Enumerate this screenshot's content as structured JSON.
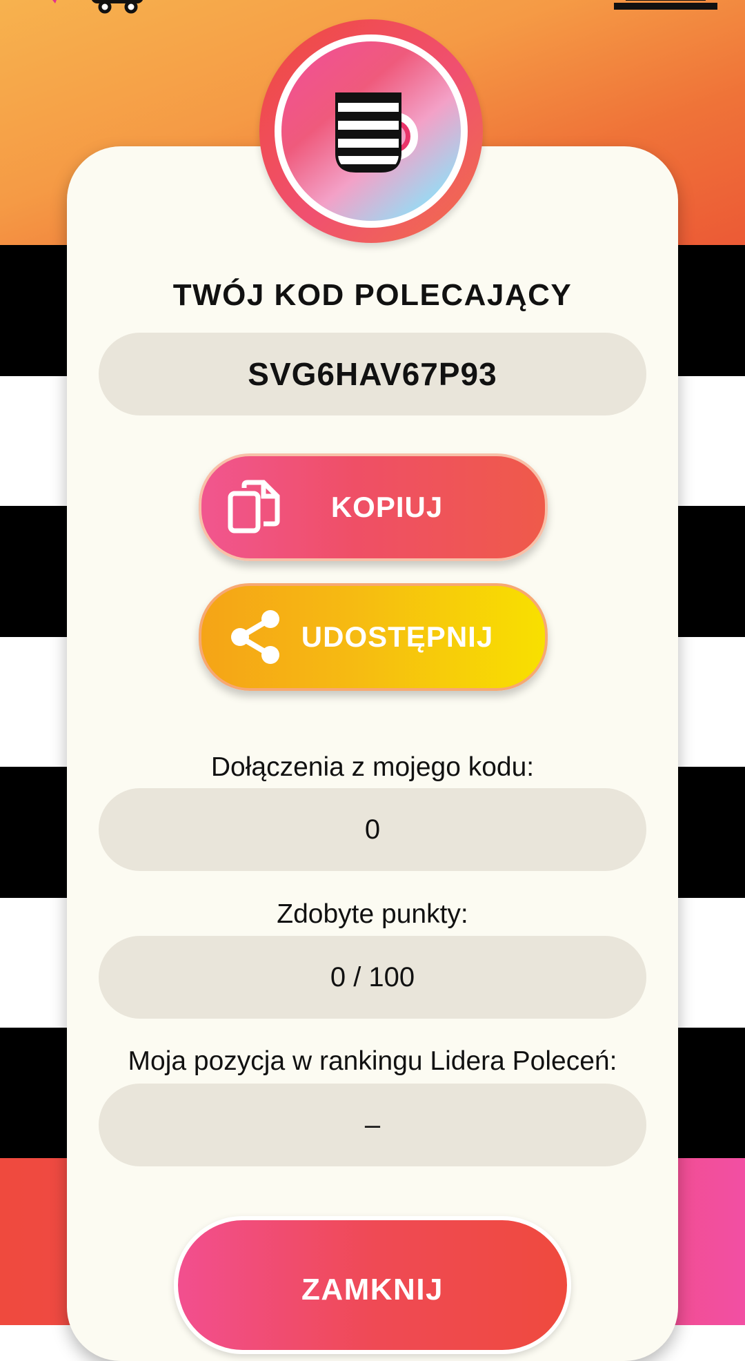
{
  "referral": {
    "title": "TWÓJ KOD POLECAJĄCY",
    "code": "SVG6HAV67P93"
  },
  "buttons": {
    "copy_label": "KOPIUJ",
    "share_label": "UDOSTĘPNIJ",
    "close_label": "ZAMKNIJ"
  },
  "stats": {
    "joins_label": "Dołączenia z mojego kodu:",
    "joins_value": "0",
    "points_label": "Zdobyte punkty:",
    "points_value": "0 / 100",
    "rank_label": "Moja pozycja w rankingu Lidera Poleceń:",
    "rank_value": "–"
  },
  "icons": {
    "badge": "mug-icon",
    "copy": "copy-icon",
    "share": "share-icon"
  },
  "colors": {
    "accent_pink": "#ef4f66",
    "accent_yellow": "#f6bb12",
    "card_bg": "#fcfbf2",
    "pill_bg": "#e9e5da"
  }
}
